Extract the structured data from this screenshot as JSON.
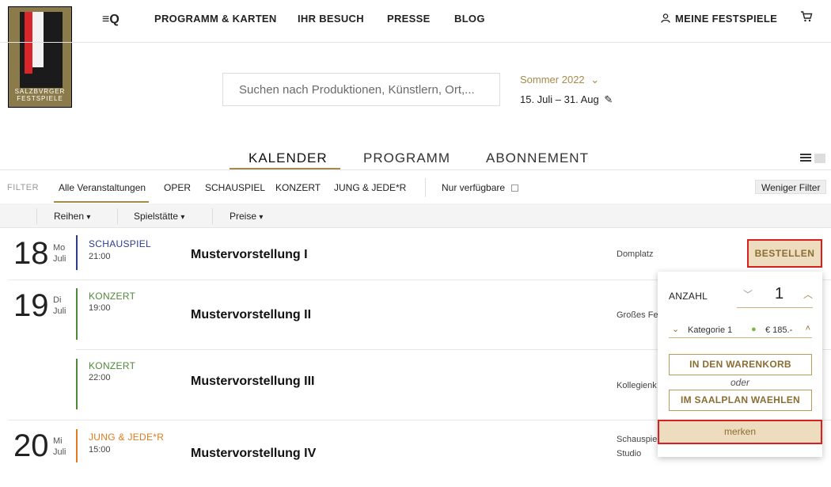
{
  "header": {
    "logo_text_1": "SALZBVRGER",
    "logo_text_2": "FESTSPIELE",
    "menu_glyph": "≡Q",
    "nav": [
      "PROGRAMM & KARTEN",
      "IHR BESUCH",
      "PRESSE",
      "BLOG"
    ],
    "account": "MEINE FESTSPIELE",
    "cart_glyph": "🛒"
  },
  "search": {
    "placeholder": "Suchen nach Produktionen, Künstlern, Ort,...",
    "season": "Sommer 2022",
    "daterange": "15. Juli – 31. Aug"
  },
  "tabs": [
    "KALENDER",
    "PROGRAMM",
    "ABONNEMENT"
  ],
  "filter": {
    "label": "FILTER",
    "items": [
      "Alle Veranstaltungen",
      "OPER",
      "SCHAUSPIEL",
      "KONZERT",
      "JUNG & JEDE*R"
    ],
    "available": "Nur verfügbare",
    "less": "Weniger Filter"
  },
  "subfilters": [
    "Reihen",
    "Spielstätte",
    "Preise"
  ],
  "events": [
    {
      "day": "18",
      "dow": "Mo",
      "month": "Juli",
      "category": "SCHAUSPIEL",
      "time": "21:00",
      "title": "Mustervorstellung I",
      "venue": "Domplatz"
    },
    {
      "day": "19",
      "dow": "Di",
      "month": "Juli",
      "category": "KONZERT",
      "time": "19:00",
      "title": "Mustervorstellung II",
      "venue": "Großes Fe"
    },
    {
      "day": "",
      "dow": "",
      "month": "",
      "category": "KONZERT",
      "time": "22:00",
      "title": "Mustervorstellung III",
      "venue": "Kollegienk"
    },
    {
      "day": "20",
      "dow": "Mi",
      "month": "Juli",
      "category": "JUNG & JEDE*R",
      "time": "15:00",
      "title": "Mustervorstellung IV",
      "venue": "Schauspie",
      "venue2": "Studio"
    }
  ],
  "order_button": "BESTELLEN",
  "popup": {
    "quantity_label": "ANZAHL",
    "quantity": "1",
    "category": "Kategorie 1",
    "price": "€ 185.-",
    "add_to_cart": "IN DEN WARENKORB",
    "or": "oder",
    "seatplan": "IM SAALPLAN WAEHLEN",
    "remember": "merken"
  },
  "colors": {
    "accent": "#a58a4a",
    "schauspiel": "#2c3e8c",
    "konzert": "#4f8a3a",
    "jung": "#e07b1f",
    "highlight_border": "#d9201f"
  }
}
